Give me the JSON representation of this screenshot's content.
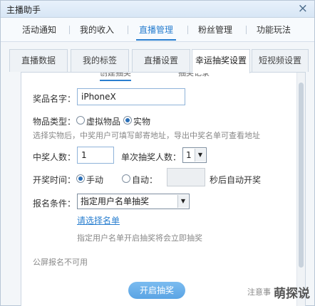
{
  "window": {
    "title": "主播助手",
    "close_glyph": "×"
  },
  "main_tabs": [
    {
      "label": "活动通知"
    },
    {
      "label": "我的收入"
    },
    {
      "label": "直播管理"
    },
    {
      "label": "粉丝管理"
    },
    {
      "label": "功能玩法"
    }
  ],
  "sub_tabs": [
    {
      "label": "直播数据"
    },
    {
      "label": "我的标签"
    },
    {
      "label": "直播设置"
    },
    {
      "label": "幸运抽奖设置"
    },
    {
      "label": "短视频设置"
    }
  ],
  "inner_tabs": [
    {
      "label": "创建抽奖"
    },
    {
      "label": "抽奖记录"
    }
  ],
  "form": {
    "prize_name_label": "奖品名字：",
    "prize_name_value": "iPhoneX",
    "type_label": "物品类型：",
    "type_virtual": "虚拟物品",
    "type_physical": "实物",
    "type_hint": "选择实物后，中奖用户可填写邮寄地址，导出中奖名单可查看地址",
    "winners_label": "中奖人数：",
    "winners_value": "1",
    "per_draw_label": "单次抽奖人数：",
    "per_draw_value": "1",
    "draw_time_label": "开奖时间：",
    "manual_label": "手动",
    "auto_label": "自动：",
    "auto_seconds_value": "",
    "auto_suffix": "秒后自动开奖",
    "condition_label": "报名条件：",
    "condition_value": "指定用户名单抽奖",
    "choose_list_link": "请选择名单",
    "condition_hint": "指定用户名单开启抽奖将会立即抽奖",
    "fullscreen_unavailable": "公屏报名不可用",
    "start_button": "开启抽奖",
    "note_text": "注意事"
  },
  "watermark": "萌探说",
  "colors": {
    "accent": "#2a7fd0",
    "button": "#5aa4e4"
  }
}
